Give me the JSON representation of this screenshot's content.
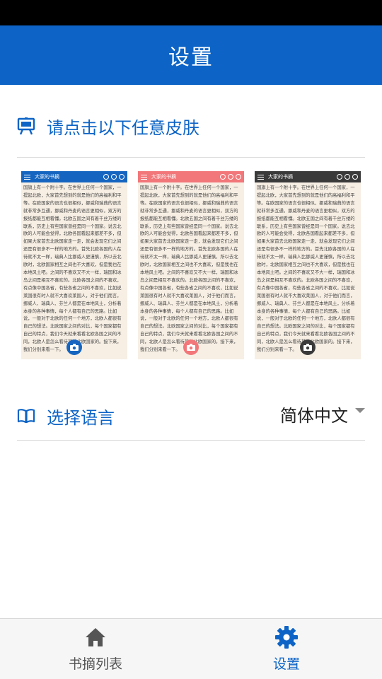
{
  "header": {
    "title": "设置"
  },
  "skin_section": {
    "label": "请点击以下任意皮肤"
  },
  "skins": [
    {
      "title": "大家的书摘",
      "color": "#1565c0"
    },
    {
      "title": "大家的书摘",
      "color": "#f2777a"
    },
    {
      "title": "大家的书摘",
      "color": "#3a3a3a"
    }
  ],
  "sample_text": "国旗上有一个附十字。在世界上任何一个国家，一提起北欧，大家首先想到的就是他们的高福利和平等。在欧国家的语言也很相似，挪威和瑞典的语言就非常多互通，挪威和丹麦的语言更相似，双方的报纸都能互相看懂。北欧五国之间有着千丝万缕的联系，历史上有些国家曾经是同一个国家。说去北欧的人可能会觉得，北欧各国看起来都差不多，但如果大家首去北欧国家走一走，就会发现它们之间还是有很多不一样的地方的。首先北欧各国的人在待就不太一样，瑞典人比挪威人更谨慎，所以去北欧时，北欧国家相互之间也不大喜欢，但是我也在本地风土吧。之间的不喜欢又不大一样，瑞国和冰岛之间是相互不喜欢的。北欧各国之间的不喜欢，有点像中国各省，有些各省之间的不喜欢，比如说莱国很有时人就不大喜欢莱国人，对于他们而言，挪威人、瑞典人、芬兰人都是在本地风土，分析着本身的各种事情，每个人都有自己的思路。比如说，一般对于北欧的任何一个地方，北欧人都很有自己的想法。北欧国家之间的对比，每个国家都有自己的特点，我们今天就来看看北欧各国之间的不同，北欧人是怎么看待其他北欧国家的。接下来，我们分别来看一下。",
  "language": {
    "label": "选择语言",
    "value": "简体中文"
  },
  "bottom_nav": {
    "items": [
      {
        "label": "书摘列表"
      },
      {
        "label": "设置"
      }
    ]
  },
  "colors": {
    "primary": "#0d64c6",
    "status_bar": "#000000",
    "skin_bg": "#f7efe4"
  }
}
